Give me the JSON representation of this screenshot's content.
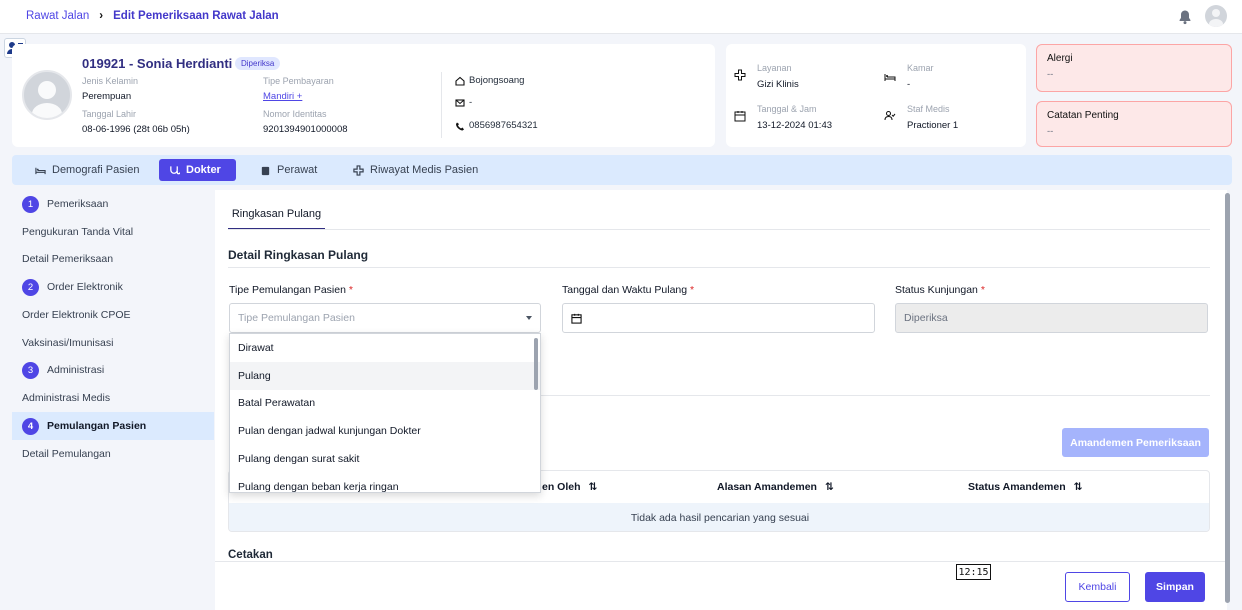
{
  "breadcrumb": {
    "parent": "Rawat Jalan",
    "current": "Edit Pemeriksaan Rawat Jalan"
  },
  "patient": {
    "name": "019921 - Sonia Herdianti",
    "status_badge": "Diperiksa",
    "gender_label": "Jenis Kelamin",
    "gender": "Perempuan",
    "birth_label": "Tanggal Lahir",
    "birth": "08-06-1996 (28t 06b 05h)",
    "payment_label": "Tipe Pembayaran",
    "payment": "Mandiri +",
    "id_label": "Nomor Identitas",
    "id_number": "9201394901000008",
    "address": "Bojongsoang",
    "email": "-",
    "phone": "0856987654321"
  },
  "service": {
    "layanan_label": "Layanan",
    "layanan": "Gizi Klinis",
    "kamar_label": "Kamar",
    "kamar": "-",
    "datetime_label": "Tanggal & Jam",
    "datetime": "13-12-2024 01:43",
    "staff_label": "Staf Medis",
    "staff": "Practioner 1"
  },
  "alerts": {
    "alergi_label": "Alergi",
    "alergi": "--",
    "catatan_label": "Catatan Penting",
    "catatan": "--"
  },
  "tabs": [
    {
      "label": "Demografi Pasien",
      "icon": "bed-icon"
    },
    {
      "label": "Dokter",
      "icon": "doctor-icon",
      "active": true
    },
    {
      "label": "Perawat",
      "icon": "nurse-icon"
    },
    {
      "label": "Riwayat Medis Pasien",
      "icon": "medical-cross-icon"
    }
  ],
  "nav": {
    "items": [
      {
        "num": "1",
        "label": "Pemeriksaan"
      },
      {
        "label": "Pengukuran Tanda Vital"
      },
      {
        "label": "Detail Pemeriksaan"
      },
      {
        "num": "2",
        "label": "Order Elektronik"
      },
      {
        "label": "Order Elektronik CPOE"
      },
      {
        "label": "Vaksinasi/Imunisasi"
      },
      {
        "num": "3",
        "label": "Administrasi"
      },
      {
        "label": "Administrasi Medis"
      },
      {
        "num": "4",
        "label": "Pemulangan Pasien",
        "active": true
      },
      {
        "label": "Detail Pemulangan"
      }
    ]
  },
  "main": {
    "subtab": "Ringkasan Pulang",
    "section_title": "Detail Ringkasan Pulang",
    "field_tipe_label": "Tipe Pemulangan Pasien",
    "field_tipe_placeholder": "Tipe Pemulangan Pasien",
    "field_tanggal_label": "Tanggal dan Waktu Pulang",
    "field_status_label": "Status Kunjungan",
    "field_status_value": "Diperiksa",
    "required_mark": "*",
    "dropdown_options": [
      "Dirawat",
      "Pulang",
      "Batal Perawatan",
      "Pulan dengan jadwal kunjungan Dokter",
      "Pulang dengan surat sakit",
      "Pulang dengan beban kerja ringan"
    ],
    "amend_button": "Amandemen Pemeriksaan",
    "table_headers": [
      "en Oleh",
      "Alasan Amandemen",
      "Status Amandemen"
    ],
    "table_empty": "Tidak ada hasil pencarian yang sesuai",
    "cetakan": "Cetakan"
  },
  "footer": {
    "kembali": "Kembali",
    "simpan": "Simpan"
  },
  "tooltip_time": "12:15",
  "colors": {
    "accent": "#4f46e5",
    "alert_bg": "#fde8e8",
    "tab_bar": "#dbeafe"
  }
}
